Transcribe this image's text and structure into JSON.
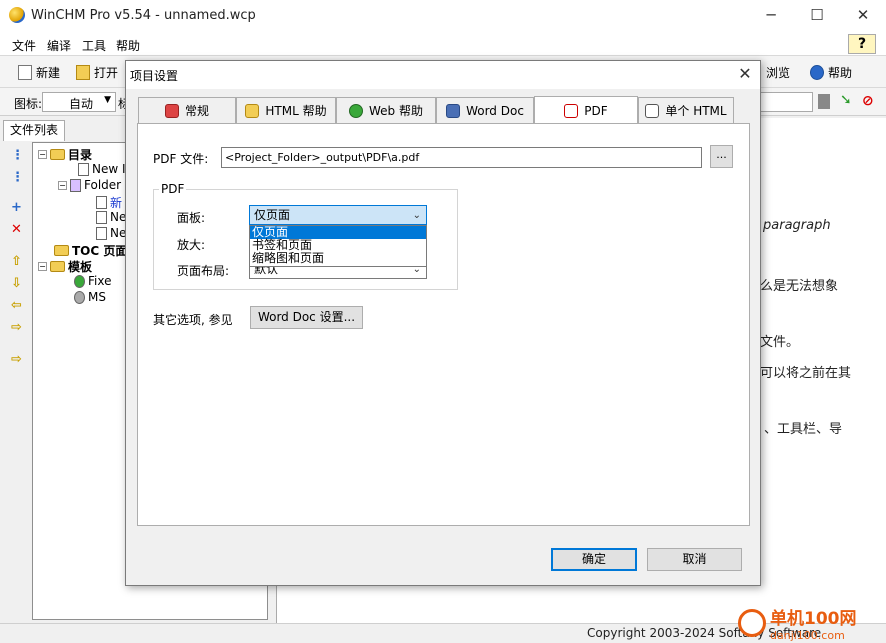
{
  "app": {
    "title": "WinCHM Pro v5.54 - unnamed.wcp",
    "minimize": "─",
    "maximize": "☐",
    "close": "✕"
  },
  "menu": [
    "文件",
    "编译",
    "工具",
    "帮助"
  ],
  "toolbar": {
    "new_label": "新建",
    "open_label": "打开",
    "browse_label": "浏览",
    "help_label": "帮助"
  },
  "toolbar2": {
    "icon_label": "图标:",
    "icon_value": "自动",
    "partial": "标"
  },
  "left_panel": {
    "tab": "文件列表",
    "tree": [
      {
        "label": "目录",
        "bold": true
      },
      {
        "label": "New It"
      },
      {
        "label": "Folder"
      },
      {
        "label": "新"
      },
      {
        "label": "Ne"
      },
      {
        "label": "Ne"
      },
      {
        "label": "TOC 页面",
        "bold": true
      },
      {
        "label": "模板",
        "bold": true
      },
      {
        "label": "Fixe"
      },
      {
        "label": "MS"
      }
    ]
  },
  "editor": {
    "lines": [
      "paragraph",
      "么是无法想象",
      "文件。",
      "可以将之前在其",
      "、工具栏、导"
    ]
  },
  "status": {
    "copyright": "Copyright 2003-2024 Softany Software"
  },
  "watermark": {
    "name": "单机100网",
    "url": "danji100.com"
  },
  "dialog": {
    "title": "项目设置",
    "close": "✕",
    "tabs": [
      {
        "label": "常规",
        "icon": "general-icon"
      },
      {
        "label": "HTML 帮助",
        "icon": "html-help-icon"
      },
      {
        "label": "Web 帮助",
        "icon": "web-help-icon"
      },
      {
        "label": "Word Doc",
        "icon": "word-doc-icon"
      },
      {
        "label": "PDF",
        "icon": "pdf-icon",
        "active": true
      },
      {
        "label": "单个 HTML",
        "icon": "single-html-icon"
      }
    ],
    "pdf_file_label": "PDF 文件:",
    "pdf_file_value": "<Project_Folder>_output\\PDF\\a.pdf",
    "browse_label": "...",
    "group_title": "PDF",
    "panel_label": "面板:",
    "panel_value": "仅页面",
    "panel_options": [
      "仅页面",
      "书签和页面",
      "缩略图和页面"
    ],
    "zoom_label": "放大:",
    "layout_label": "页面布局:",
    "layout_value": "默认",
    "other_options_label": "其它选项, 参见",
    "word_doc_settings": "Word Doc 设置...",
    "ok": "确定",
    "cancel": "取消"
  }
}
